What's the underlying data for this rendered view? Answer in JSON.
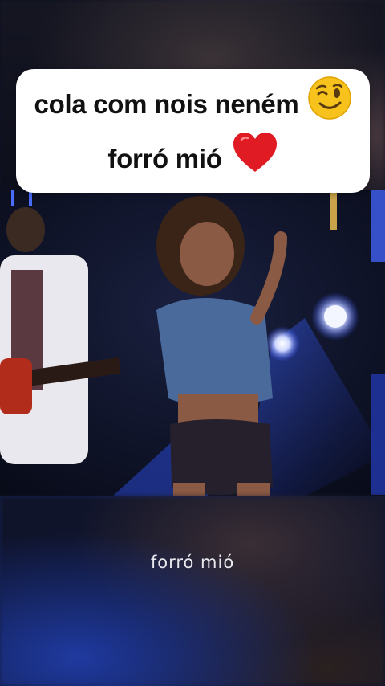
{
  "caption": {
    "line1": "cola com nois neném",
    "line1_emoji": "winking-face-emoji",
    "line2": "forró mió",
    "line2_emoji": "red-heart-emoji"
  },
  "subtitle": "forró mió",
  "colors": {
    "card": "#ffffff",
    "text": "#111111",
    "heart": "#e01b24",
    "emoji_face": "#f7c21b"
  }
}
